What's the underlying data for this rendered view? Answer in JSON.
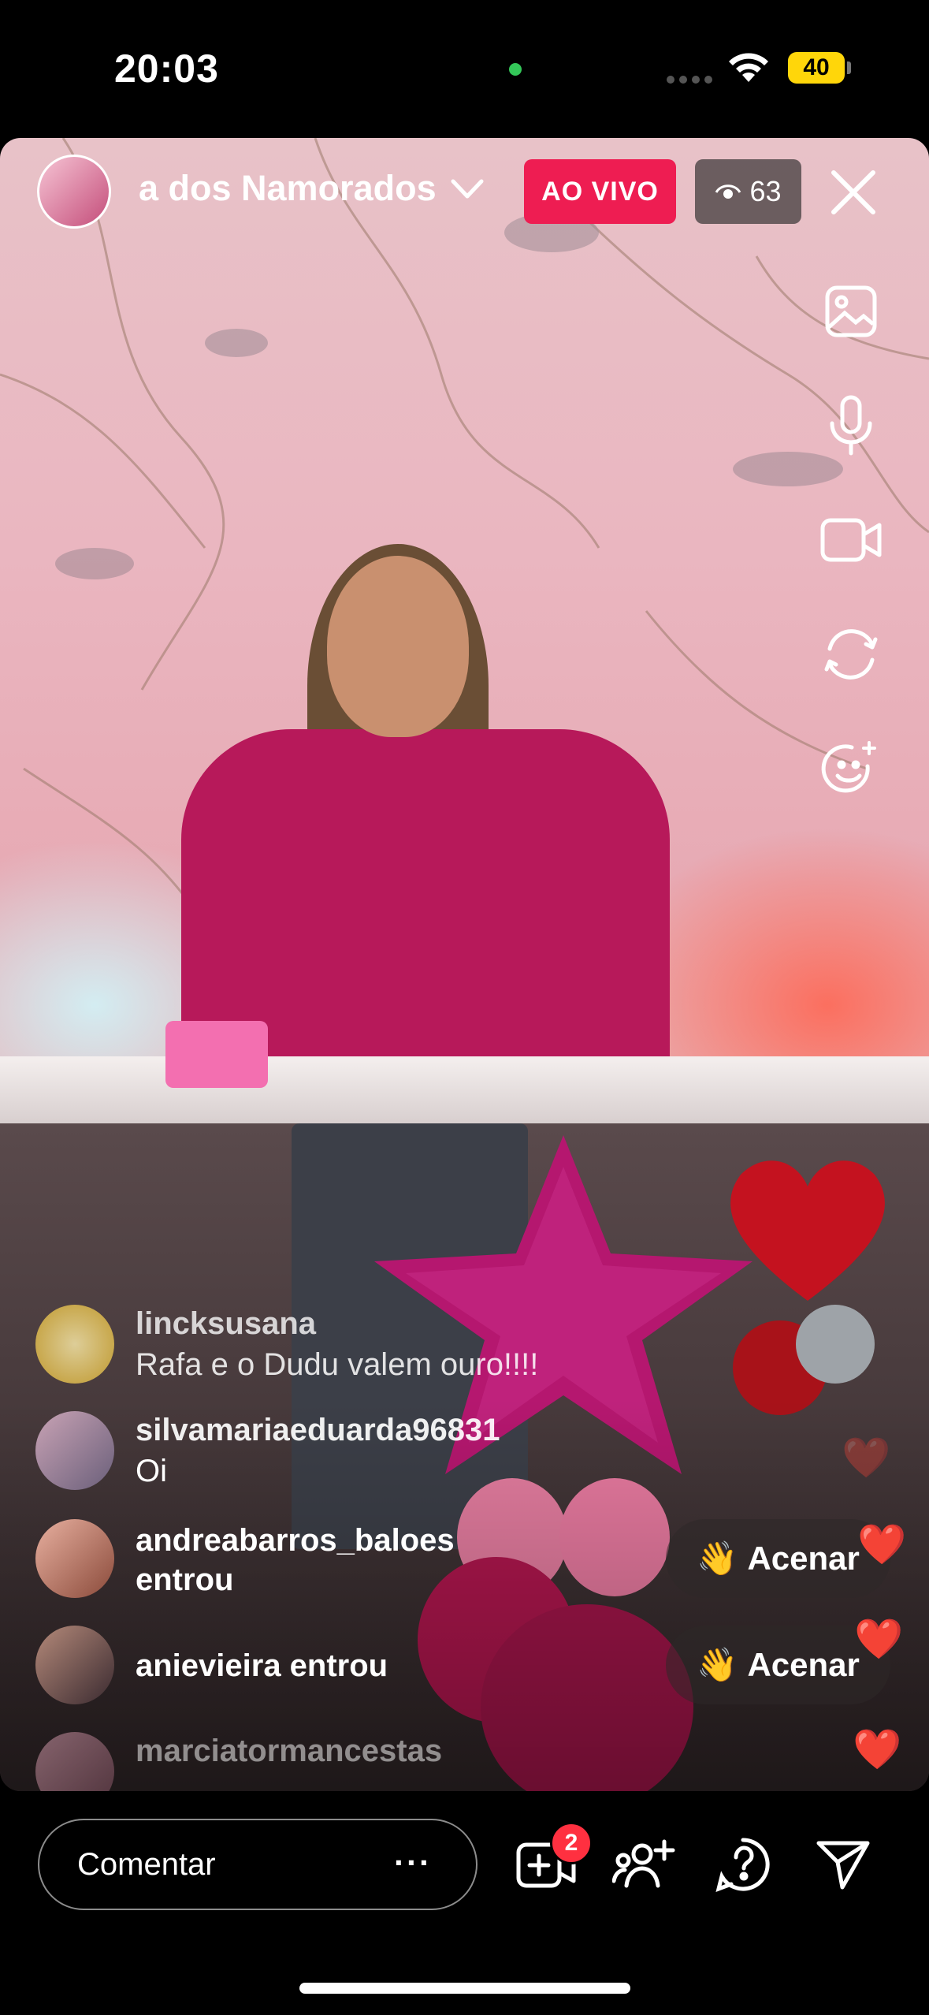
{
  "status_bar": {
    "time": "20:03",
    "battery": "40",
    "icons": [
      "wifi-icon",
      "signal-dots-icon",
      "battery-icon"
    ]
  },
  "header": {
    "title": "a dos Namorados",
    "live_label": "AO VIVO",
    "viewers": "63",
    "icons": [
      "chevron-down-icon",
      "eye-icon",
      "close-icon"
    ]
  },
  "side_tools": [
    "gallery-icon",
    "microphone-icon",
    "video-camera-icon",
    "flip-camera-icon",
    "face-effects-icon"
  ],
  "comments": [
    {
      "user": "lincksusana",
      "message": "Rafa e o Dudu valem ouro!!!!"
    },
    {
      "user": "silvamariaeduarda96831",
      "message": "Oi"
    },
    {
      "line1": "andreabarros_baloes",
      "line2": "entrou",
      "wave_label": "Acenar"
    },
    {
      "line1": "anievieira entrou",
      "wave_label": "Acenar"
    },
    {
      "user": "marciatormancestas"
    }
  ],
  "wave_emoji": "👋",
  "heart_emoji": "❤️",
  "bottom": {
    "comment_placeholder": "Comentar",
    "more": "···",
    "request_badge": "2",
    "icons": [
      "add-guest-video-icon",
      "invite-user-icon",
      "question-icon",
      "share-send-icon"
    ]
  },
  "colors": {
    "live_badge": "#ee1d52",
    "battery": "#ffd60a",
    "badge": "#ff3040"
  }
}
